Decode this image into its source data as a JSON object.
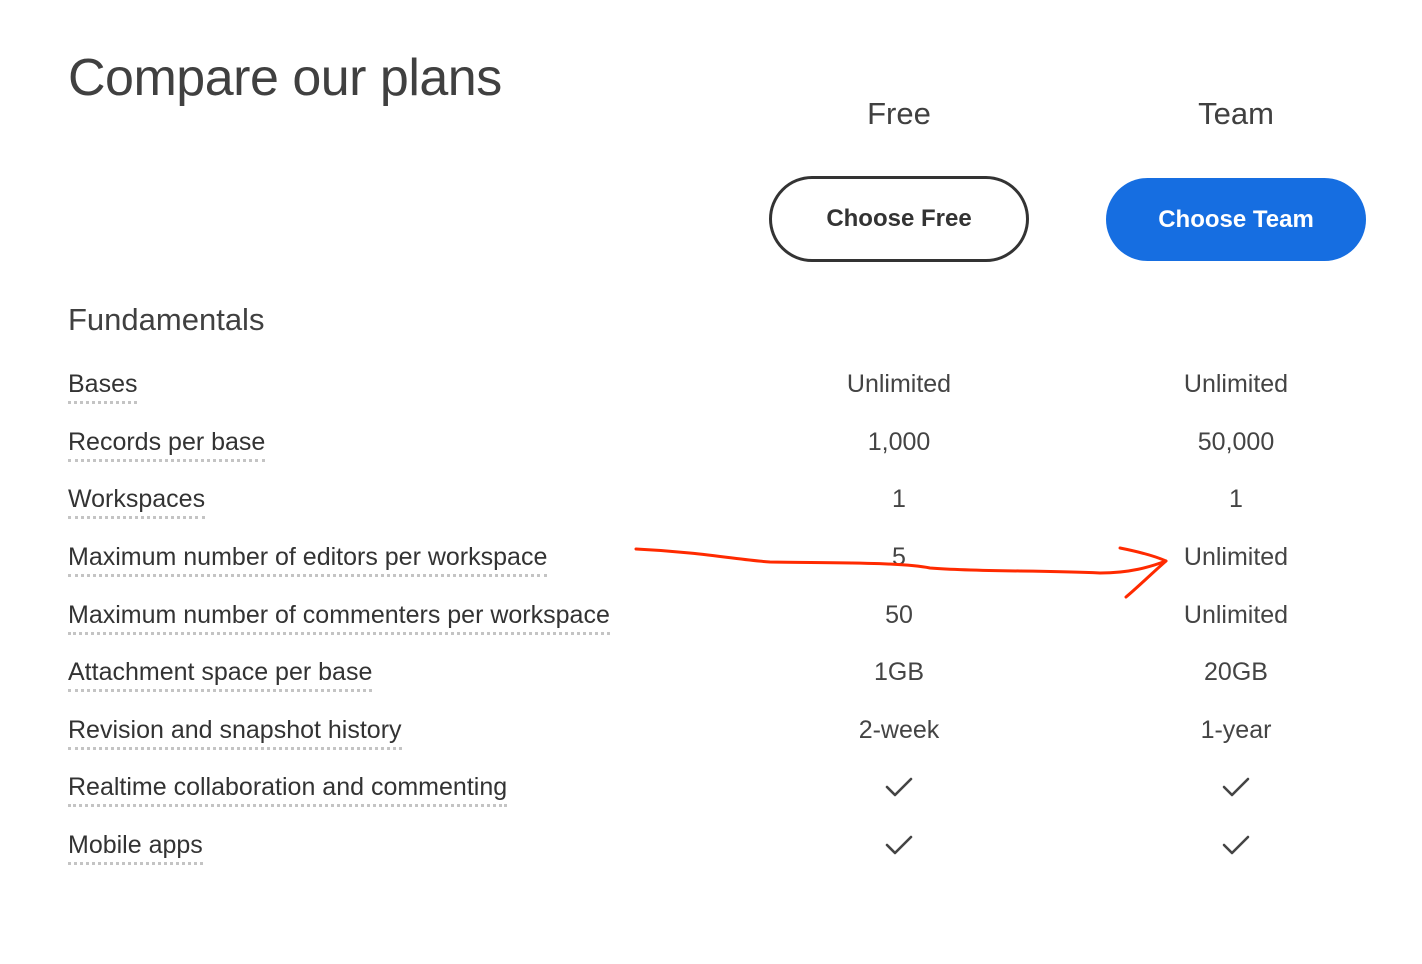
{
  "page": {
    "title": "Compare our plans",
    "section_title": "Fundamentals"
  },
  "plans": {
    "free": {
      "name": "Free",
      "button_label": "Choose Free"
    },
    "team": {
      "name": "Team",
      "button_label": "Choose Team"
    }
  },
  "colors": {
    "team_button": "#166ee1",
    "annotation_arrow": "#ff2a00"
  },
  "features": [
    {
      "label": "Bases",
      "free": "Unlimited",
      "team": "Unlimited"
    },
    {
      "label": "Records per base",
      "free": "1,000",
      "team": "50,000"
    },
    {
      "label": "Workspaces",
      "free": "1",
      "team": "1"
    },
    {
      "label": "Maximum number of editors per workspace",
      "free": "5",
      "team": "Unlimited"
    },
    {
      "label": "Maximum number of commenters per workspace",
      "free": "50",
      "team": "Unlimited"
    },
    {
      "label": "Attachment space per base",
      "free": "1GB",
      "team": "20GB"
    },
    {
      "label": "Revision and snapshot history",
      "free": "2-week",
      "team": "1-year"
    },
    {
      "label": "Realtime collaboration and commenting",
      "free_icon": "checkmark-icon",
      "team_icon": "checkmark-icon"
    },
    {
      "label": "Mobile apps",
      "free_icon": "checkmark-icon",
      "team_icon": "checkmark-icon"
    }
  ],
  "annotation": {
    "icon": "red-hand-drawn-arrow"
  }
}
